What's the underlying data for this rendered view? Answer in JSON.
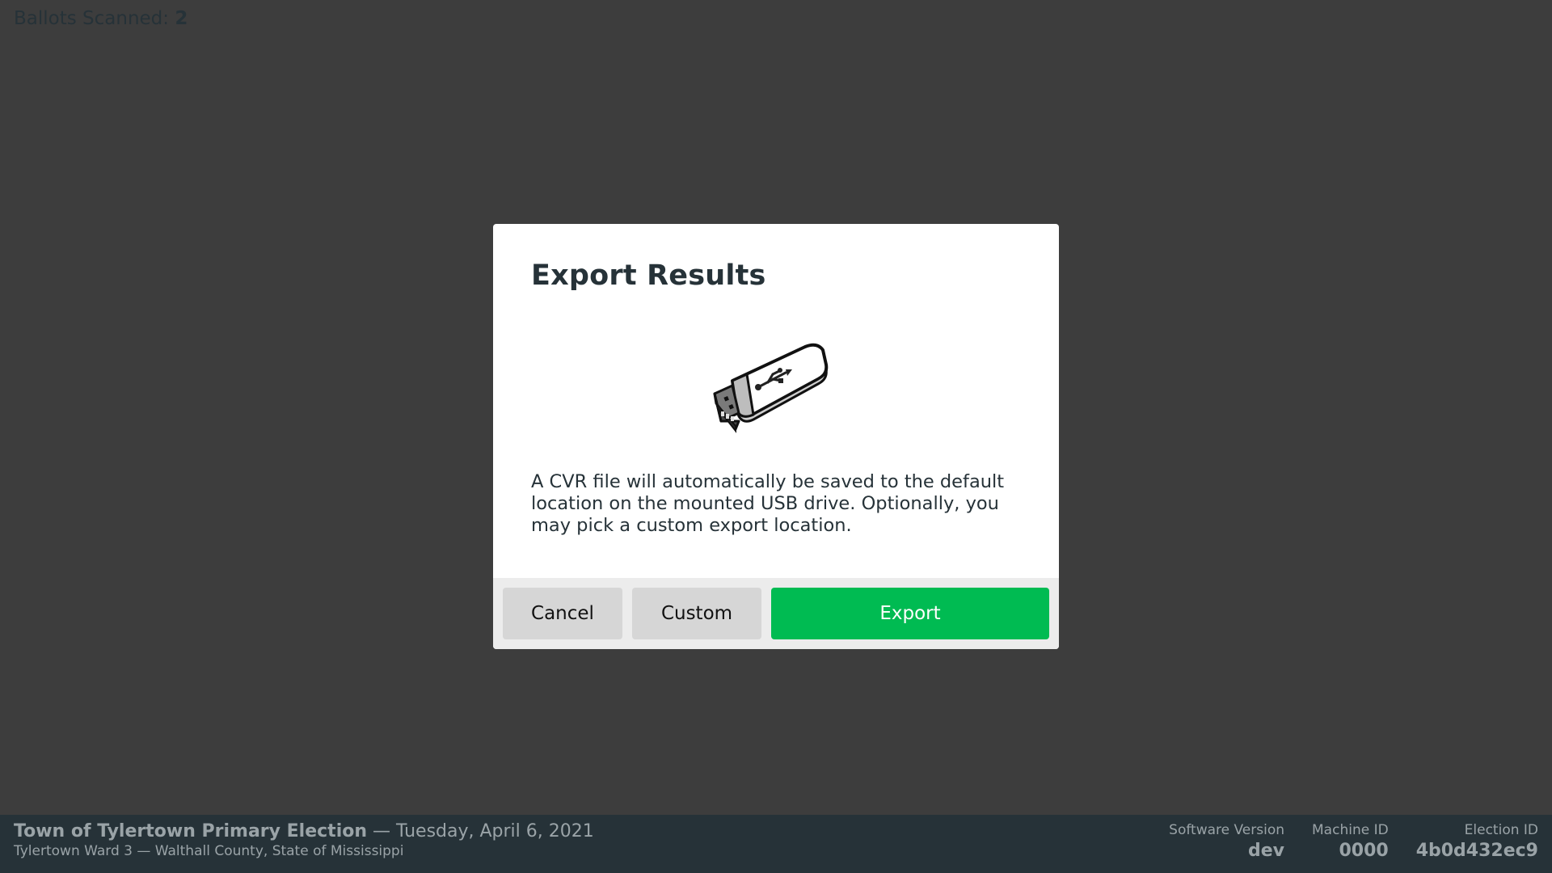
{
  "status": {
    "ballots_label": "Ballots Scanned:",
    "ballots_count": "2"
  },
  "modal": {
    "title": "Export Results",
    "icon": "usb-drive-icon",
    "message": "A CVR file will automatically be saved to the default location on the mounted USB drive. Optionally, you may pick a custom export location.",
    "buttons": {
      "cancel": "Cancel",
      "custom": "Custom",
      "export": "Export"
    }
  },
  "footer": {
    "election_title": "Town of Tylertown Primary Election",
    "election_date": " — Tuesday, April 6, 2021",
    "precinct": "Tylertown Ward 3 — Walthall County, State of Mississippi",
    "software_version_label": "Software Version",
    "software_version": "dev",
    "machine_id_label": "Machine ID",
    "machine_id": "0000",
    "election_id_label": "Election ID",
    "election_id": "4b0d432ec9"
  },
  "colors": {
    "background": "#3d3d3d",
    "export_button": "#00bb52",
    "footer": "#263238"
  }
}
